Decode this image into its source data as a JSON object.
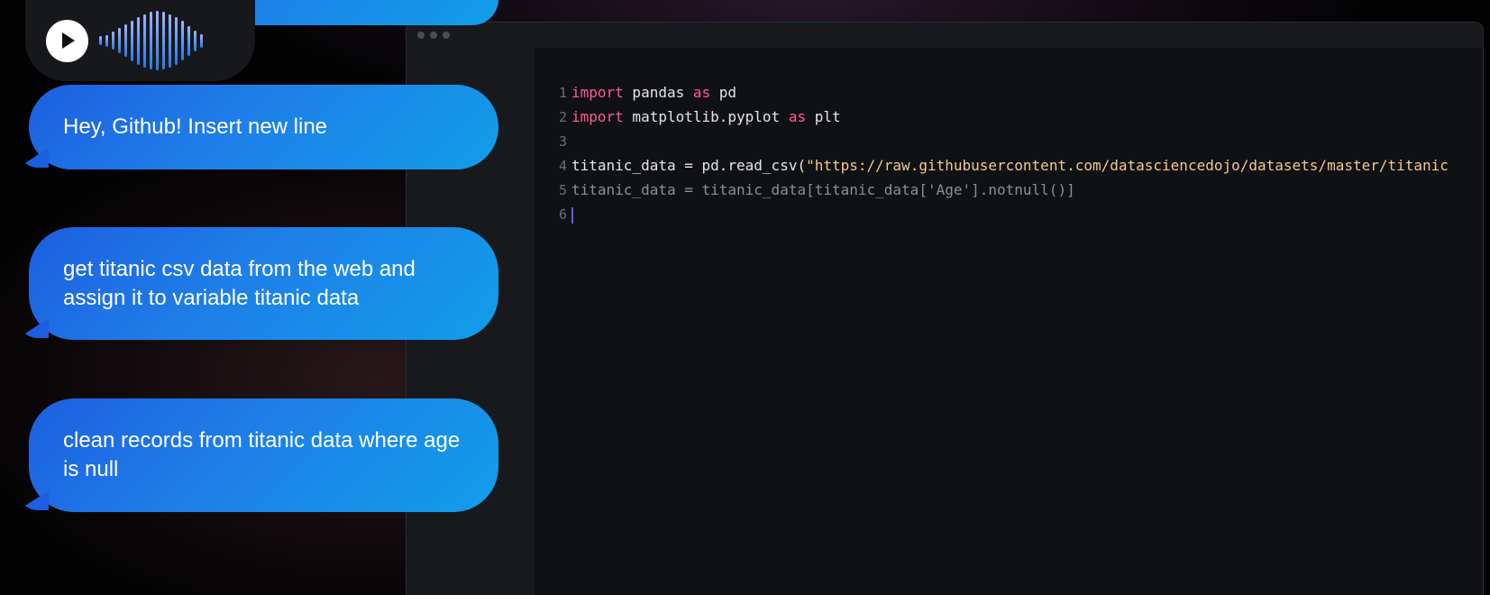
{
  "voice_note": {
    "waveform_levels": [
      0.15,
      0.2,
      0.3,
      0.42,
      0.55,
      0.68,
      0.8,
      0.9,
      0.97,
      1.0,
      0.97,
      0.9,
      0.8,
      0.66,
      0.5,
      0.35,
      0.22
    ]
  },
  "chat": {
    "messages": [
      "Hey, Github! Insert new line",
      "get titanic csv data from the web and assign it to variable titanic data",
      "clean records from titanic data where age is null"
    ]
  },
  "editor": {
    "lines": [
      {
        "num": "1",
        "kw1": "import",
        "mid": " pandas ",
        "kw2": "as",
        "tail": " pd"
      },
      {
        "num": "2",
        "kw1": "import",
        "mid": " matplotlib.pyplot ",
        "kw2": "as",
        "tail": " plt"
      },
      {
        "num": "3"
      },
      {
        "num": "4",
        "code": "titanic_data = pd.read_csv(",
        "string": "\"https://raw.githubusercontent.com/datasciencedojo/datasets/master/titanic"
      },
      {
        "num": "5",
        "code": "titanic_data = titanic_data[titanic_data['Age'].notnull()]"
      },
      {
        "num": "6"
      }
    ]
  },
  "colors": {
    "bubble_start": "#1d5fe0",
    "bubble_end": "#119ee8",
    "keyword": "#ff5c8a",
    "string": "#f5c98b",
    "cursor": "#6b5bd6"
  }
}
